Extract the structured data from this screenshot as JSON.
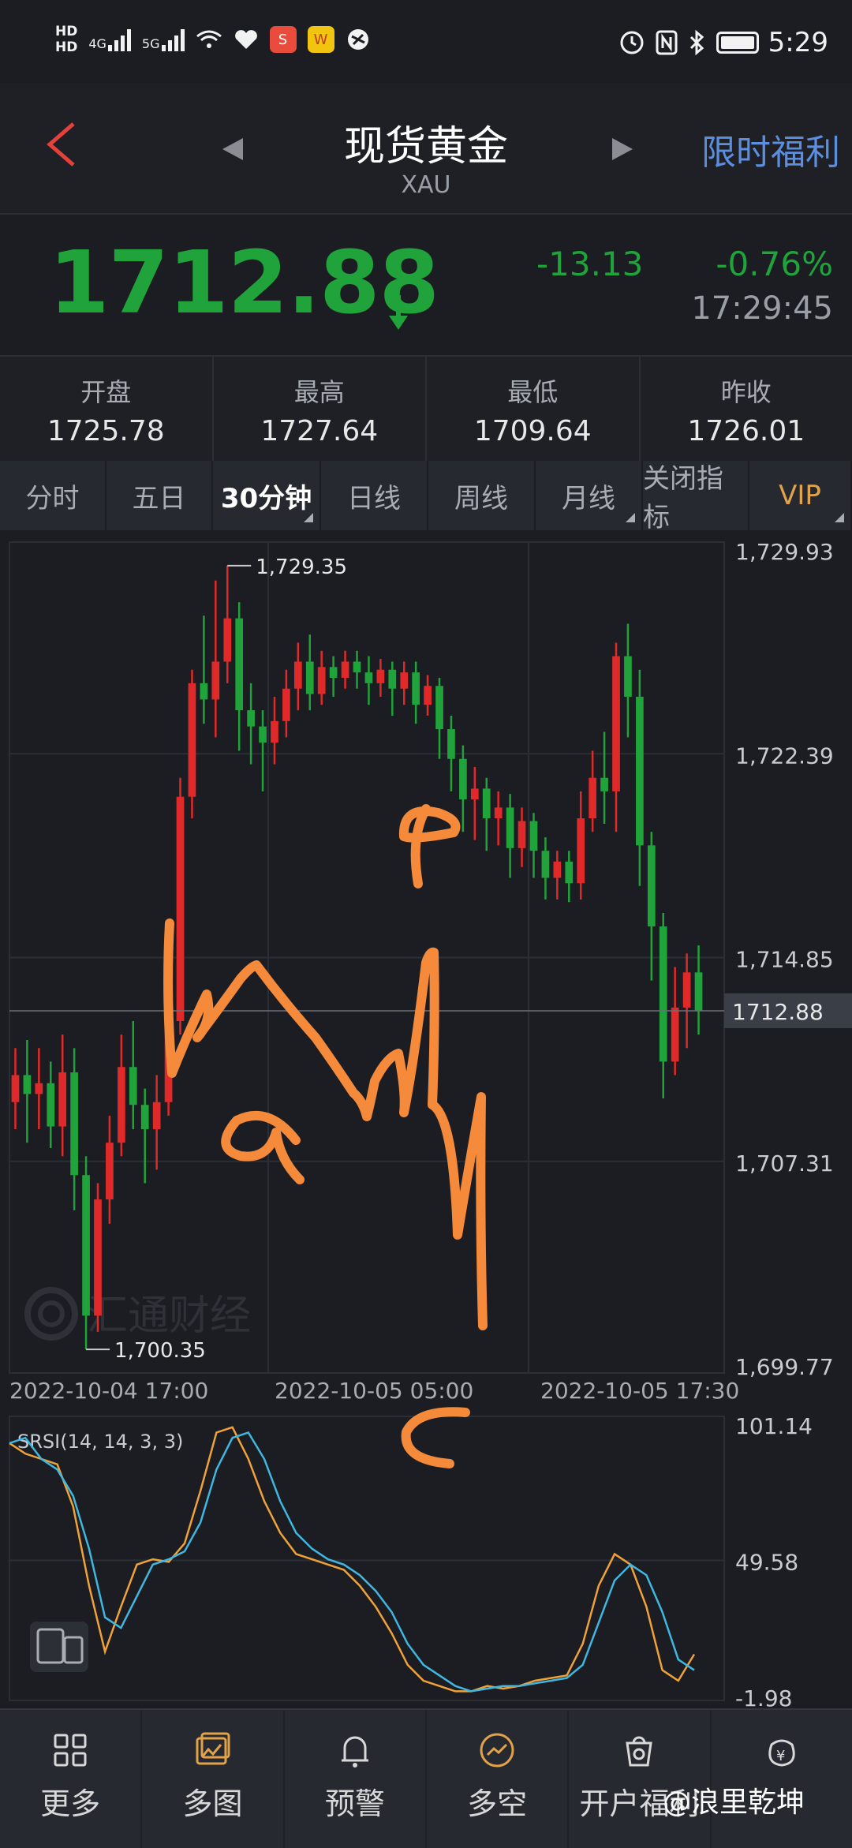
{
  "status_bar": {
    "hd1": "HD",
    "hd2": "HD",
    "net1": "4G",
    "net2": "5G",
    "time": "5:29",
    "icons": [
      "wifi-icon",
      "heart-icon",
      "sina-icon",
      "weibo-icon",
      "app-icon",
      "alarm-icon",
      "nfc-icon",
      "bluetooth-icon",
      "battery-icon"
    ]
  },
  "header": {
    "title": "现货黄金",
    "subtitle": "XAU",
    "promo": "限时福利"
  },
  "quote": {
    "price": "1712.88",
    "change": "-13.13",
    "change_pct": "-0.76%",
    "time": "17:29:45",
    "down_color": "#1fa33a"
  },
  "stats": [
    {
      "label": "开盘",
      "value": "1725.78"
    },
    {
      "label": "最高",
      "value": "1727.64"
    },
    {
      "label": "最低",
      "value": "1709.64"
    },
    {
      "label": "昨收",
      "value": "1726.01"
    }
  ],
  "tabs": [
    {
      "label": "分时",
      "active": false
    },
    {
      "label": "五日",
      "active": false
    },
    {
      "label": "30分钟",
      "active": true
    },
    {
      "label": "日线",
      "active": false
    },
    {
      "label": "周线",
      "active": false
    },
    {
      "label": "月线",
      "active": false
    },
    {
      "label": "关闭指标",
      "active": false
    },
    {
      "label": "VIP",
      "active": false
    }
  ],
  "chart_data": {
    "type": "candlestick",
    "ylim": [
      1699.77,
      1729.93
    ],
    "yticks": [
      "1,729.93",
      "1,722.39",
      "1,714.85",
      "1,707.31",
      "1,699.77"
    ],
    "current_price_label": "1712.88",
    "current_price": 1712.88,
    "max_label": "1,729.35",
    "max_value": 1729.35,
    "min_label": "1,700.35",
    "min_value": 1700.35,
    "xticks": [
      "2022-10-04 17:00",
      "2022-10-05 05:00",
      "2022-10-05 17:30"
    ],
    "watermark": "汇通财经",
    "up_color": "#e02a2a",
    "down_color": "#1fa33a",
    "candles": [
      [
        1709.5,
        1710.5,
        1708.5,
        1711.5
      ],
      [
        1710.5,
        1709.8,
        1708.0,
        1711.8
      ],
      [
        1709.8,
        1710.2,
        1708.5,
        1711.5
      ],
      [
        1710.2,
        1708.6,
        1707.8,
        1711.0
      ],
      [
        1708.6,
        1710.6,
        1707.5,
        1712.0
      ],
      [
        1710.6,
        1706.8,
        1705.5,
        1711.5
      ],
      [
        1706.8,
        1701.6,
        1700.35,
        1707.5
      ],
      [
        1701.6,
        1705.9,
        1701.0,
        1706.5
      ],
      [
        1705.9,
        1708.0,
        1705.0,
        1709.0
      ],
      [
        1708.0,
        1710.8,
        1707.5,
        1712.0
      ],
      [
        1710.8,
        1709.4,
        1708.5,
        1712.5
      ],
      [
        1709.4,
        1708.5,
        1706.5,
        1710.0
      ],
      [
        1708.5,
        1709.5,
        1707.0,
        1710.5
      ],
      [
        1709.5,
        1712.5,
        1709.0,
        1713.5
      ],
      [
        1712.5,
        1720.8,
        1712.0,
        1721.5
      ],
      [
        1720.8,
        1725.0,
        1720.0,
        1725.5
      ],
      [
        1725.0,
        1724.4,
        1723.5,
        1727.5
      ],
      [
        1724.4,
        1725.8,
        1723.0,
        1728.8
      ],
      [
        1725.8,
        1727.4,
        1725.0,
        1729.35
      ],
      [
        1727.4,
        1724.0,
        1722.5,
        1728.0
      ],
      [
        1724.0,
        1723.4,
        1722.0,
        1725.0
      ],
      [
        1723.4,
        1722.8,
        1721.0,
        1724.0
      ],
      [
        1722.8,
        1723.6,
        1722.0,
        1724.5
      ],
      [
        1723.6,
        1724.8,
        1723.0,
        1725.5
      ],
      [
        1724.8,
        1725.8,
        1724.0,
        1726.5
      ],
      [
        1725.8,
        1724.6,
        1724.0,
        1726.8
      ],
      [
        1724.6,
        1725.6,
        1724.2,
        1726.2
      ],
      [
        1725.6,
        1725.2,
        1724.5,
        1726.0
      ],
      [
        1725.2,
        1725.8,
        1724.8,
        1726.2
      ],
      [
        1725.8,
        1725.4,
        1724.8,
        1726.2
      ],
      [
        1725.4,
        1725.0,
        1724.2,
        1726.0
      ],
      [
        1725.0,
        1725.5,
        1724.5,
        1725.9
      ],
      [
        1725.5,
        1724.8,
        1723.8,
        1725.8
      ],
      [
        1724.8,
        1725.4,
        1724.2,
        1725.8
      ],
      [
        1725.4,
        1724.2,
        1723.5,
        1725.8
      ],
      [
        1724.2,
        1724.9,
        1723.8,
        1725.3
      ],
      [
        1724.9,
        1723.3,
        1722.2,
        1725.2
      ],
      [
        1723.3,
        1722.2,
        1721.0,
        1723.8
      ],
      [
        1722.2,
        1720.7,
        1719.5,
        1722.7
      ],
      [
        1720.7,
        1721.1,
        1719.2,
        1721.9
      ],
      [
        1721.1,
        1720.0,
        1718.8,
        1721.5
      ],
      [
        1720.0,
        1720.4,
        1719.0,
        1721.0
      ],
      [
        1720.4,
        1718.9,
        1717.8,
        1720.9
      ],
      [
        1718.9,
        1719.9,
        1718.2,
        1720.4
      ],
      [
        1719.9,
        1718.8,
        1717.8,
        1720.2
      ],
      [
        1718.8,
        1717.8,
        1717.0,
        1719.3
      ],
      [
        1717.8,
        1718.4,
        1717.0,
        1718.8
      ],
      [
        1718.4,
        1717.6,
        1716.9,
        1718.8
      ],
      [
        1717.6,
        1720.0,
        1717.0,
        1721.0
      ],
      [
        1720.0,
        1721.5,
        1719.5,
        1722.5
      ],
      [
        1721.5,
        1721.0,
        1719.8,
        1723.2
      ],
      [
        1721.0,
        1726.0,
        1719.5,
        1726.5
      ],
      [
        1726.0,
        1724.5,
        1723.0,
        1727.2
      ],
      [
        1724.5,
        1719.0,
        1717.5,
        1725.5
      ],
      [
        1719.0,
        1716.0,
        1714.0,
        1719.5
      ],
      [
        1716.0,
        1711.0,
        1709.64,
        1716.5
      ],
      [
        1711.0,
        1713.0,
        1710.5,
        1714.5
      ],
      [
        1713.0,
        1714.3,
        1711.5,
        1715.0
      ],
      [
        1714.3,
        1712.88,
        1712.0,
        1715.3
      ]
    ]
  },
  "indicator": {
    "label": "SRSI(14, 14, 3, 3)",
    "ylim": [
      -1.98,
      101.14
    ],
    "yticks": [
      "101.14",
      "49.58",
      "-1.98"
    ],
    "colors": {
      "k": "#f0a23a",
      "d": "#3fb7e0"
    },
    "k": [
      94,
      90,
      88,
      86,
      70,
      40,
      15,
      32,
      48,
      50,
      49,
      56,
      76,
      98,
      100,
      88,
      72,
      60,
      52,
      50,
      48,
      46,
      40,
      32,
      22,
      10,
      4,
      2,
      0,
      0,
      2,
      1,
      2,
      4,
      5,
      6,
      18,
      40,
      52,
      48,
      32,
      8,
      4,
      14
    ],
    "d": [
      94,
      96,
      88,
      84,
      74,
      54,
      28,
      24,
      36,
      48,
      50,
      53,
      64,
      84,
      96,
      98,
      88,
      72,
      60,
      54,
      50,
      48,
      44,
      38,
      30,
      18,
      10,
      6,
      2,
      0,
      1,
      2,
      2,
      3,
      4,
      5,
      10,
      26,
      42,
      48,
      44,
      30,
      12,
      8
    ]
  },
  "overlay_handwriting": [
    "a",
    "b",
    "c"
  ],
  "bottom_nav": [
    {
      "label": "更多",
      "icon": "grid-icon"
    },
    {
      "label": "多图",
      "icon": "multi-chart-icon"
    },
    {
      "label": "预警",
      "icon": "bell-icon"
    },
    {
      "label": "多空",
      "icon": "long-short-icon"
    },
    {
      "label": "开户福利",
      "icon": "gift-icon"
    },
    {
      "label": "",
      "icon": "yen-bag-icon"
    }
  ],
  "watermark_user": "@浪里乾坤"
}
